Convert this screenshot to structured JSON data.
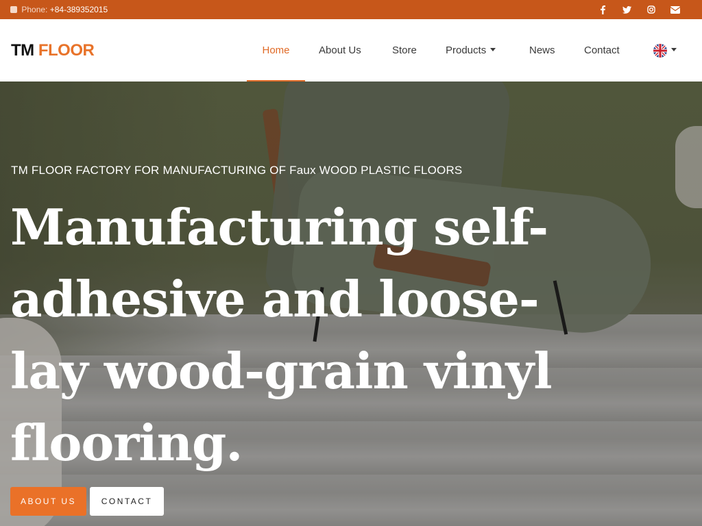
{
  "topbar": {
    "phone_label": "Phone:",
    "phone_number": "+84-389352015",
    "socials": [
      {
        "icon": "facebook-icon",
        "glyph": "f"
      },
      {
        "icon": "twitter-icon",
        "glyph": "t"
      },
      {
        "icon": "instagram-icon",
        "glyph": "ig"
      },
      {
        "icon": "envelope-icon",
        "glyph": "mail"
      }
    ]
  },
  "header": {
    "logo_part1": "TM",
    "logo_part2": "FLOOR",
    "nav": [
      {
        "label": "Home",
        "active": true
      },
      {
        "label": "About Us",
        "active": false
      },
      {
        "label": "Store",
        "active": false
      },
      {
        "label": "Products",
        "active": false,
        "dropdown": true
      },
      {
        "label": "News",
        "active": false
      },
      {
        "label": "Contact",
        "active": false
      }
    ],
    "language_icon": "uk-flag-icon"
  },
  "hero": {
    "eyebrow": "TM FLOOR FACTORY FOR MANUFACTURING OF Faux WOOD PLASTIC FLOORS",
    "headline": "Manufacturing self-adhesive and loose-lay wood-grain vinyl flooring.",
    "about_button": "ABOUT US",
    "contact_button": "CONTACT"
  },
  "colors": {
    "accent": "#e8732a",
    "topbar": "#c7571a"
  }
}
